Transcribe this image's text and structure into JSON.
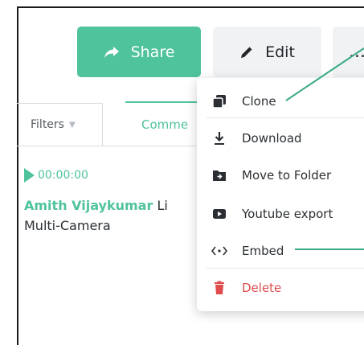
{
  "toolbar": {
    "share_label": "Share",
    "edit_label": "Edit",
    "more_label": "..."
  },
  "tabs": {
    "filters_label": "Filters",
    "comments_label": "Comme"
  },
  "comment": {
    "timestamp": "00:00:00",
    "author": "Amith Vijaykumar",
    "text_start": "Li",
    "text_line2": "Multi-Camera"
  },
  "menu": {
    "items": [
      {
        "label": "Clone",
        "icon": "clone-icon"
      },
      {
        "label": "Download",
        "icon": "download-icon"
      },
      {
        "label": "Move to Folder",
        "icon": "folder-icon"
      },
      {
        "label": "Youtube export",
        "icon": "youtube-icon"
      },
      {
        "label": "Embed",
        "icon": "embed-icon"
      },
      {
        "label": "Delete",
        "icon": "trash-icon"
      }
    ]
  },
  "colors": {
    "accent": "#4fc39c",
    "danger": "#e04b4b",
    "button_gray": "#f1f2f4",
    "text": "#2b2f33"
  }
}
